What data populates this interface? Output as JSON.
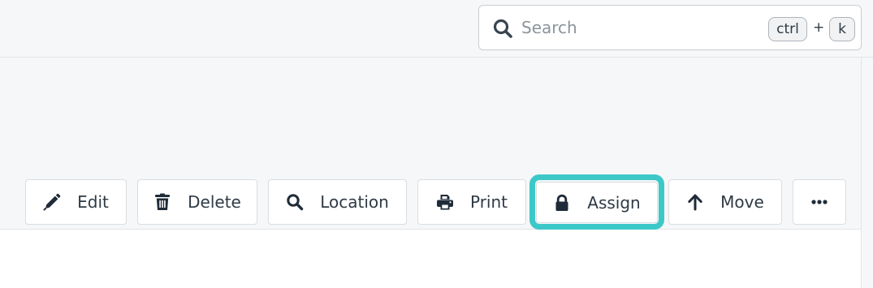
{
  "search": {
    "placeholder": "Search",
    "icon": "search-icon",
    "shortcut": {
      "modifier": "ctrl",
      "plus": "+",
      "key": "k"
    }
  },
  "toolbar": {
    "buttons": [
      {
        "label": "Edit",
        "icon": "pencil-icon"
      },
      {
        "label": "Delete",
        "icon": "trash-icon"
      },
      {
        "label": "Location",
        "icon": "search-icon"
      },
      {
        "label": "Print",
        "icon": "printer-icon"
      },
      {
        "label": "Assign",
        "icon": "lock-icon",
        "highlighted": true
      },
      {
        "label": "Move",
        "icon": "arrow-up-icon"
      },
      {
        "label": "",
        "icon": "ellipsis-icon"
      }
    ]
  },
  "colors": {
    "highlight": "#3dc8c8",
    "icon": "#1f2b38",
    "text": "#2f3a45",
    "panel_bg": "#f6f7f8"
  }
}
